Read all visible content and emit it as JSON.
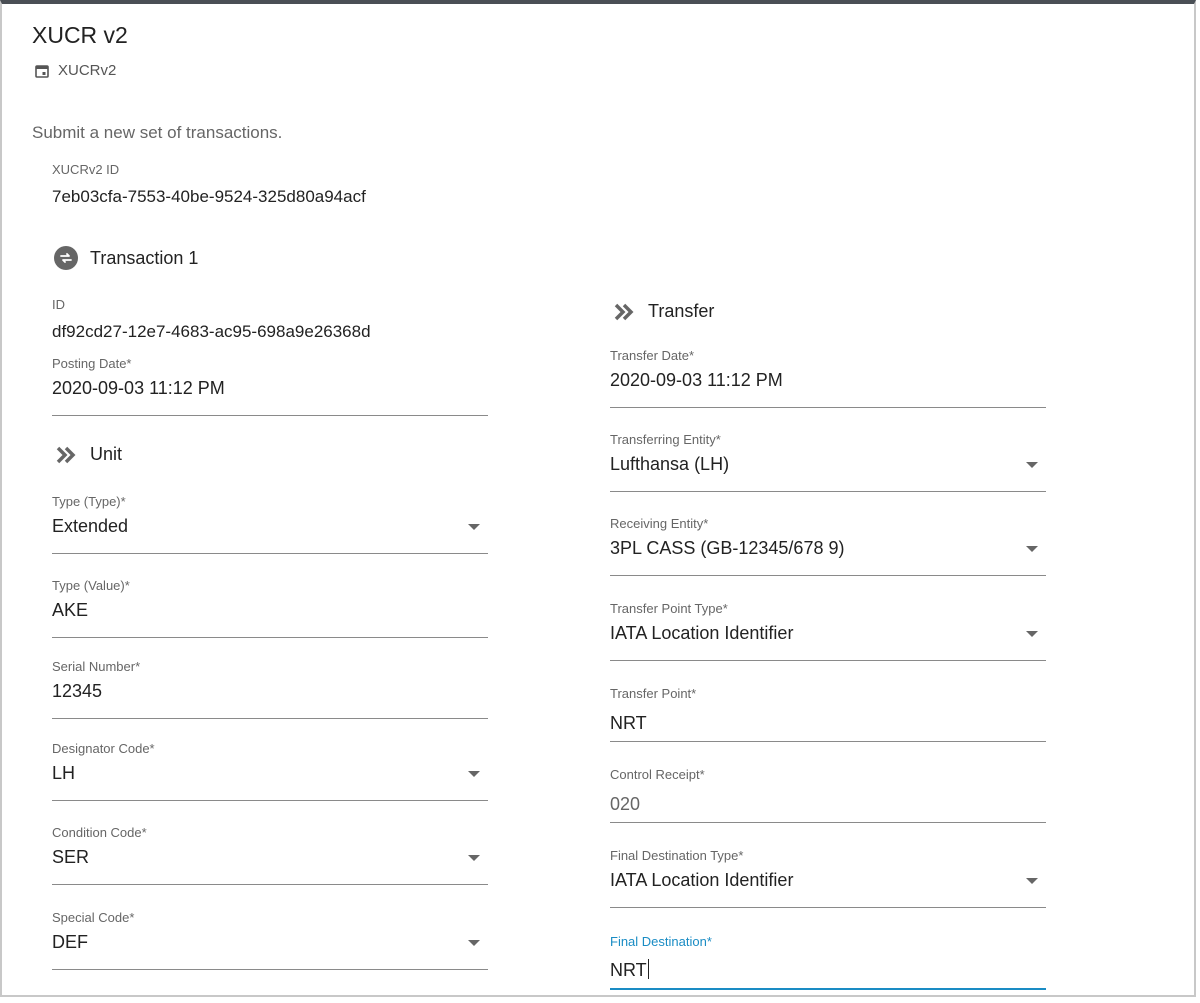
{
  "header": {
    "title": "XUCR v2",
    "subtitle": "XUCRv2",
    "description": "Submit a new set of transactions."
  },
  "xucr_id": {
    "label": "XUCRv2 ID",
    "value": "7eb03cfa-7553-40be-9524-325d80a94acf"
  },
  "transaction": {
    "heading": "Transaction 1",
    "id": {
      "label": "ID",
      "value": "df92cd27-12e7-4683-ac95-698a9e26368d"
    },
    "posting_date": {
      "label": "Posting Date*",
      "value": "2020-09-03 11:12 PM"
    }
  },
  "unit": {
    "heading": "Unit",
    "type_type": {
      "label": "Type (Type)*",
      "value": "Extended"
    },
    "type_value": {
      "label": "Type (Value)*",
      "value": "AKE"
    },
    "serial_number": {
      "label": "Serial Number*",
      "value": "12345"
    },
    "designator_code": {
      "label": "Designator Code*",
      "value": "LH"
    },
    "condition_code": {
      "label": "Condition Code*",
      "value": "SER"
    },
    "special_code": {
      "label": "Special Code*",
      "value": "DEF"
    }
  },
  "transfer": {
    "heading": "Transfer",
    "transfer_date": {
      "label": "Transfer Date*",
      "value": "2020-09-03 11:12 PM"
    },
    "transferring_entity": {
      "label": "Transferring Entity*",
      "value": "Lufthansa (LH)"
    },
    "receiving_entity": {
      "label": "Receiving Entity*",
      "value": "3PL CASS (GB-12345/678 9)"
    },
    "transfer_point_type": {
      "label": "Transfer Point Type*",
      "value": "IATA Location Identifier"
    },
    "transfer_point": {
      "label": "Transfer Point*",
      "value": "NRT"
    },
    "control_receipt": {
      "label": "Control Receipt*",
      "value": "020"
    },
    "final_destination_type": {
      "label": "Final Destination Type*",
      "value": "IATA Location Identifier"
    },
    "final_destination": {
      "label": "Final Destination*",
      "value": "NRT"
    }
  },
  "colors": {
    "accent": "#1a8cc4",
    "window_top": "#4a4f55"
  },
  "icons": {
    "subtitle": "calendar-icon",
    "transaction": "swap-icon",
    "section": "chevron-double-right-icon",
    "dropdown": "caret-down-icon"
  }
}
